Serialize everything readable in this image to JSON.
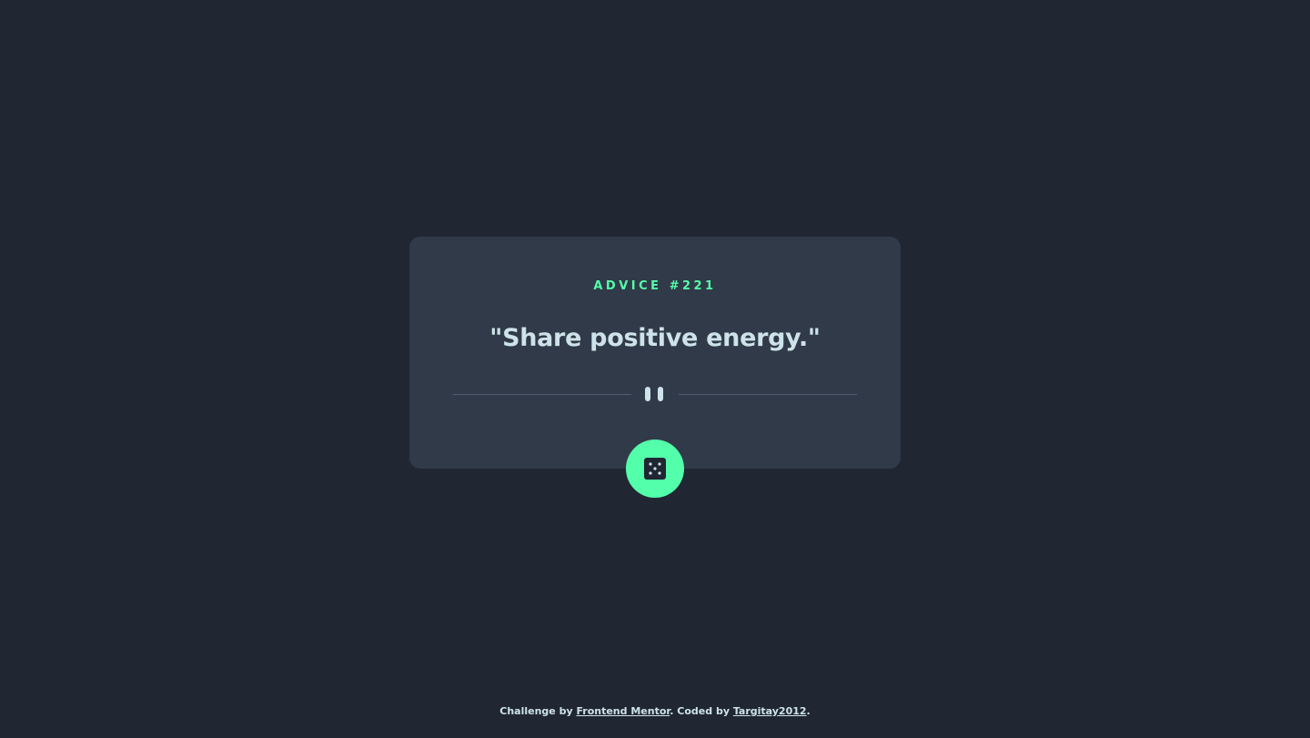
{
  "card": {
    "advice_id": "ADVICE #221",
    "advice_text": "\"Share positive energy.\""
  },
  "divider": {
    "icon": "pause-icon"
  },
  "dice_button": {
    "icon": "dice-icon"
  },
  "footer": {
    "prefix": "Challenge by ",
    "link1": "Frontend Mentor",
    "middle": ". Coded by ",
    "link2": "Targitay2012",
    "suffix": "."
  },
  "colors": {
    "background": "#202632",
    "card": "#313A48",
    "accent": "#53FFAA",
    "text": "#CEE3E9",
    "divider": "#4F5D74"
  }
}
